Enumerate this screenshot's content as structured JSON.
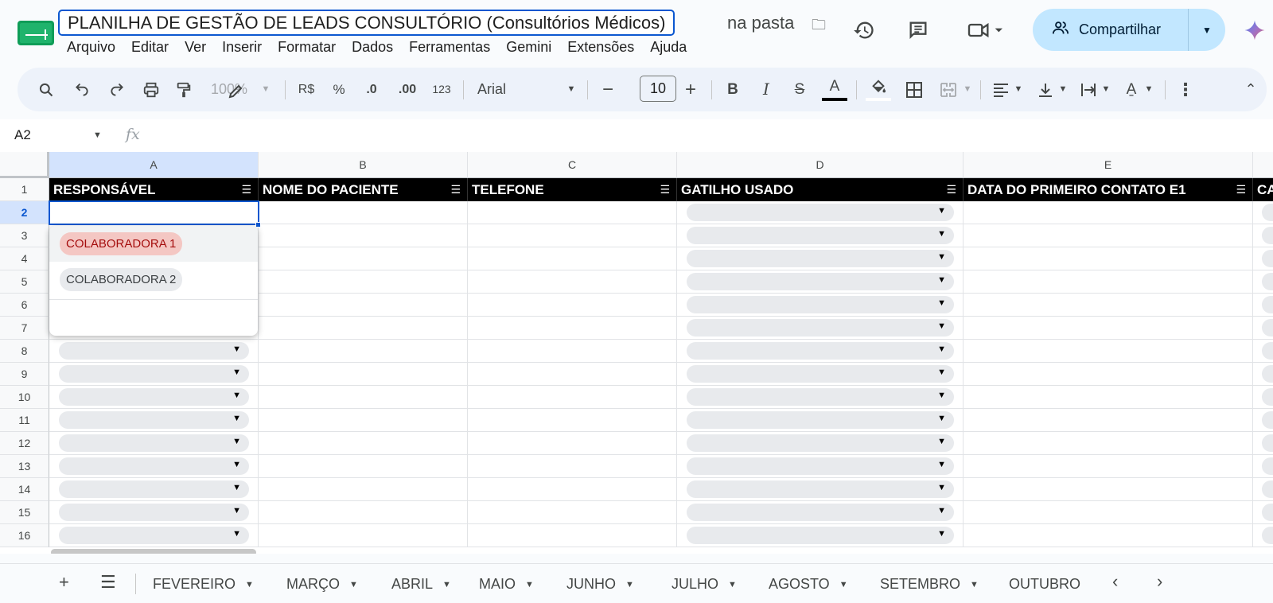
{
  "header": {
    "title": "PLANILHA DE GESTÃO DE LEADS CONSULTÓRIO (Consultórios Médicos)",
    "folder_label": "na pasta",
    "share_label": "Compartilhar",
    "menu": [
      "Arquivo",
      "Editar",
      "Ver",
      "Inserir",
      "Formatar",
      "Dados",
      "Ferramentas",
      "Gemini",
      "Extensões",
      "Ajuda"
    ]
  },
  "toolbar": {
    "zoom": "100%",
    "currency": "R$",
    "percent": "%",
    "decrease_decimal": ".0",
    "increase_decimal": ".00",
    "number_format": "123",
    "font": "Arial",
    "font_size": "10"
  },
  "formula_bar": {
    "cell_ref": "A2",
    "fx": "fx"
  },
  "grid": {
    "columns": [
      "A",
      "B",
      "C",
      "D",
      "E"
    ],
    "rows": [
      "1",
      "2",
      "3",
      "4",
      "5",
      "6",
      "7",
      "8",
      "9",
      "10",
      "11",
      "12",
      "13",
      "14",
      "15",
      "16"
    ],
    "headers": [
      "RESPONSÁVEL",
      "NOME DO PACIENTE",
      "TELEFONE",
      "GATILHO USADO",
      "DATA DO PRIMEIRO CONTATO E1",
      "CA"
    ]
  },
  "dropdown": {
    "options": [
      "COLABORADORA 1",
      "COLABORADORA 2"
    ]
  },
  "sheets": [
    "FEVEREIRO",
    "MARÇO",
    "ABRIL",
    "MAIO",
    "JUNHO",
    "JULHO",
    "AGOSTO",
    "SETEMBRO",
    "OUTUBRO"
  ]
}
